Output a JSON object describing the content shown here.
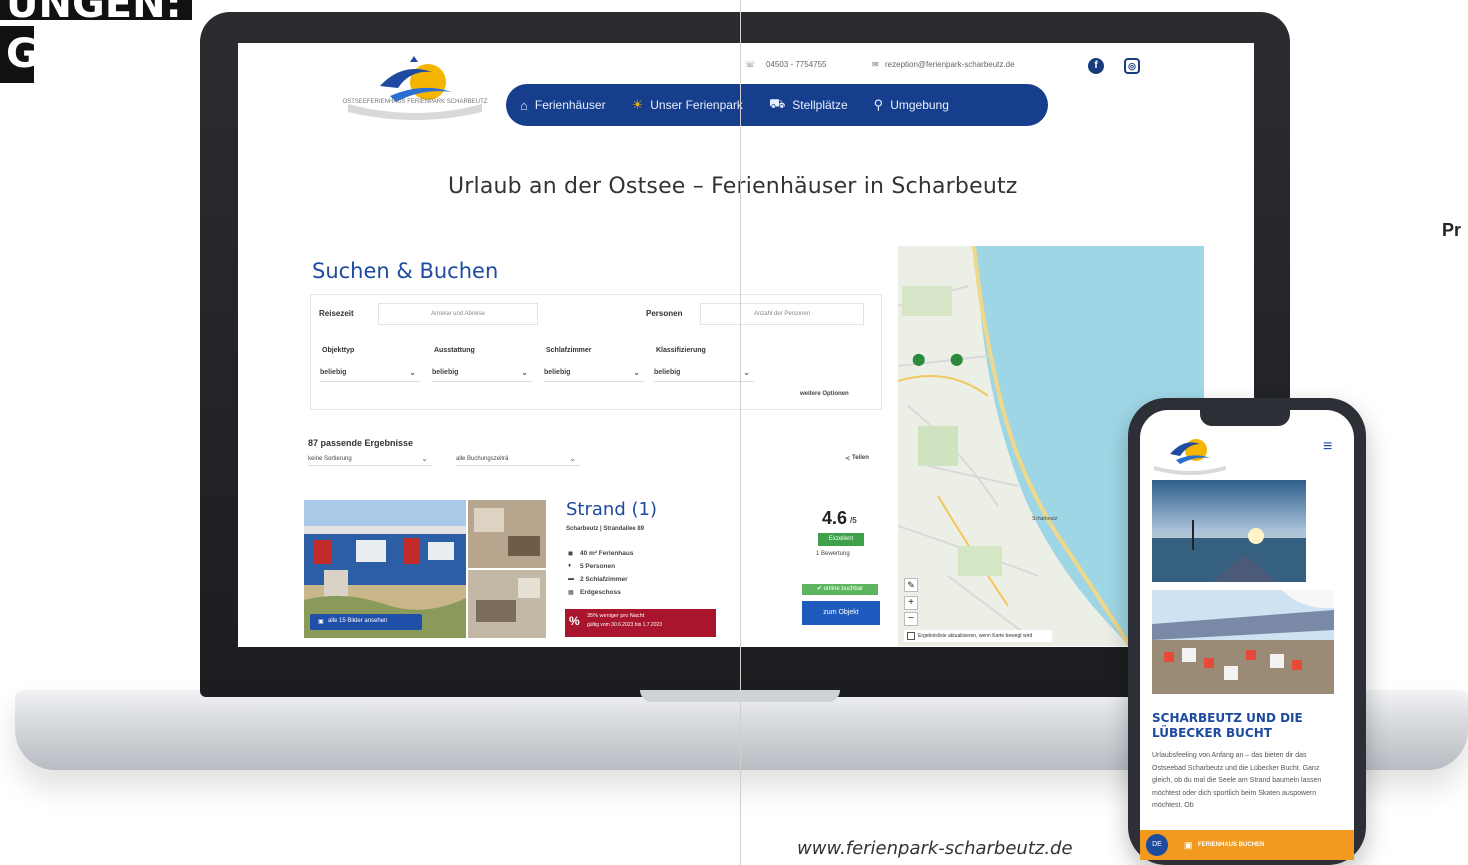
{
  "heading": {
    "line1": "UNGEN:",
    "line2": "G"
  },
  "site": {
    "phone": "04503 - 7754755",
    "email": "rezeption@ferienpark-scharbeutz.de",
    "logo_text": "OSTSEEFERIENHAUS FERIENPARK SCHARBEUTZ",
    "nav": [
      {
        "label": "Ferienhäuser",
        "icon": "house-icon",
        "glyph": "⌂"
      },
      {
        "label": "Unser Ferienpark",
        "icon": "beach-icon",
        "glyph": "☀"
      },
      {
        "label": "Stellplätze",
        "icon": "camper-icon",
        "glyph": "⛟"
      },
      {
        "label": "Umgebung",
        "icon": "binoculars-icon",
        "glyph": "⚲"
      }
    ],
    "title": "Urlaub an der Ostsee – Ferienhäuser in Scharbeutz",
    "search": {
      "title": "Suchen & Buchen",
      "travel_label": "Reisezeit",
      "travel_placeholder": "Anreise und Abreise",
      "persons_label": "Personen",
      "persons_placeholder": "Anzahl der Personen",
      "filters": [
        {
          "label": "Objekttyp",
          "value": "beliebig"
        },
        {
          "label": "Ausstattung",
          "value": "beliebig"
        },
        {
          "label": "Schlafzimmer",
          "value": "beliebig"
        },
        {
          "label": "Klassifizierung",
          "value": "beliebig"
        }
      ],
      "more_options": "weitere Optionen"
    },
    "results": {
      "count": "87 passende Ergebnisse",
      "sort": "keine Sortierung",
      "period": "alle Buchungszeiträ",
      "share": "Teilen"
    },
    "listing": {
      "name": "Strand (1)",
      "location": "Scharbeutz | Strandallee 89",
      "features": [
        "40 m² Ferienhaus",
        "5 Personen",
        "2 Schlafzimmer",
        "Erdgeschoss"
      ],
      "rating": "4.6",
      "rating_suffix": "/5",
      "rating_badge": "Exzellent",
      "reviews": "1 Bewertung",
      "bookable": "✔ online buchbar",
      "cta": "zum Objekt",
      "photos": "alle 15 Bilder ansehen",
      "promo_line1": "35% weniger pro Nacht",
      "promo_line2": "gültig vom 30.6.2023 bis 1.7.2023"
    },
    "map": {
      "footer": "Ergebnisliste aktualisieren, wenn Karte bewegt wird",
      "place": "Scharbeutz"
    }
  },
  "phone": {
    "section_title": "SCHARBEUTZ UND DIE LÜBECKER BUCHT",
    "text": "Urlaubsfeeling von Anfang an – das bieten dir das Ostseebad Scharbeutz und die Lübecker Bucht. Ganz gleich, ob du mal die Seele am Strand baumeln lassen möchtest oder dich sportlich beim Skaten auspowern möchtest. Ob",
    "book_label": "FERIENHAUS BUCHEN",
    "lang": "DE"
  },
  "url": "www.ferienpark-scharbeutz.de",
  "side_text": "Pr"
}
